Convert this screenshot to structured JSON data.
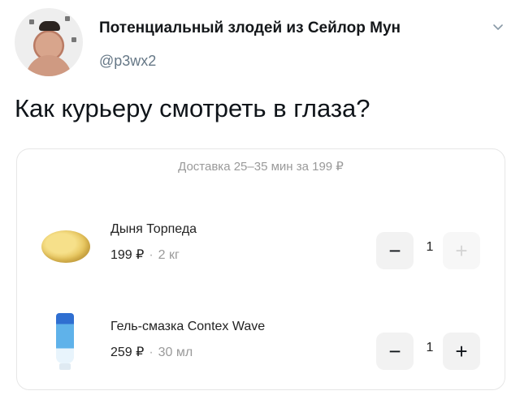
{
  "tweet": {
    "display_name": "Потенциальный злодей из Сейлор Мун",
    "handle": "@p3wx2",
    "text": "Как курьеру смотреть в глаза?",
    "more_icon": "chevron-down-icon"
  },
  "cart": {
    "delivery": "Доставка 25–35 мин за 199 ₽",
    "items": [
      {
        "name": "Дыня Торпеда",
        "price": "199 ₽",
        "separator": "·",
        "weight": "2 кг",
        "quantity": "1",
        "minus_label": "−",
        "plus_label": "+",
        "plus_disabled": true
      },
      {
        "name": "Гель-смазка Contex Wave",
        "price": "259 ₽",
        "separator": "·",
        "weight": "30 мл",
        "quantity": "1",
        "minus_label": "−",
        "plus_label": "+",
        "plus_disabled": false
      }
    ]
  }
}
